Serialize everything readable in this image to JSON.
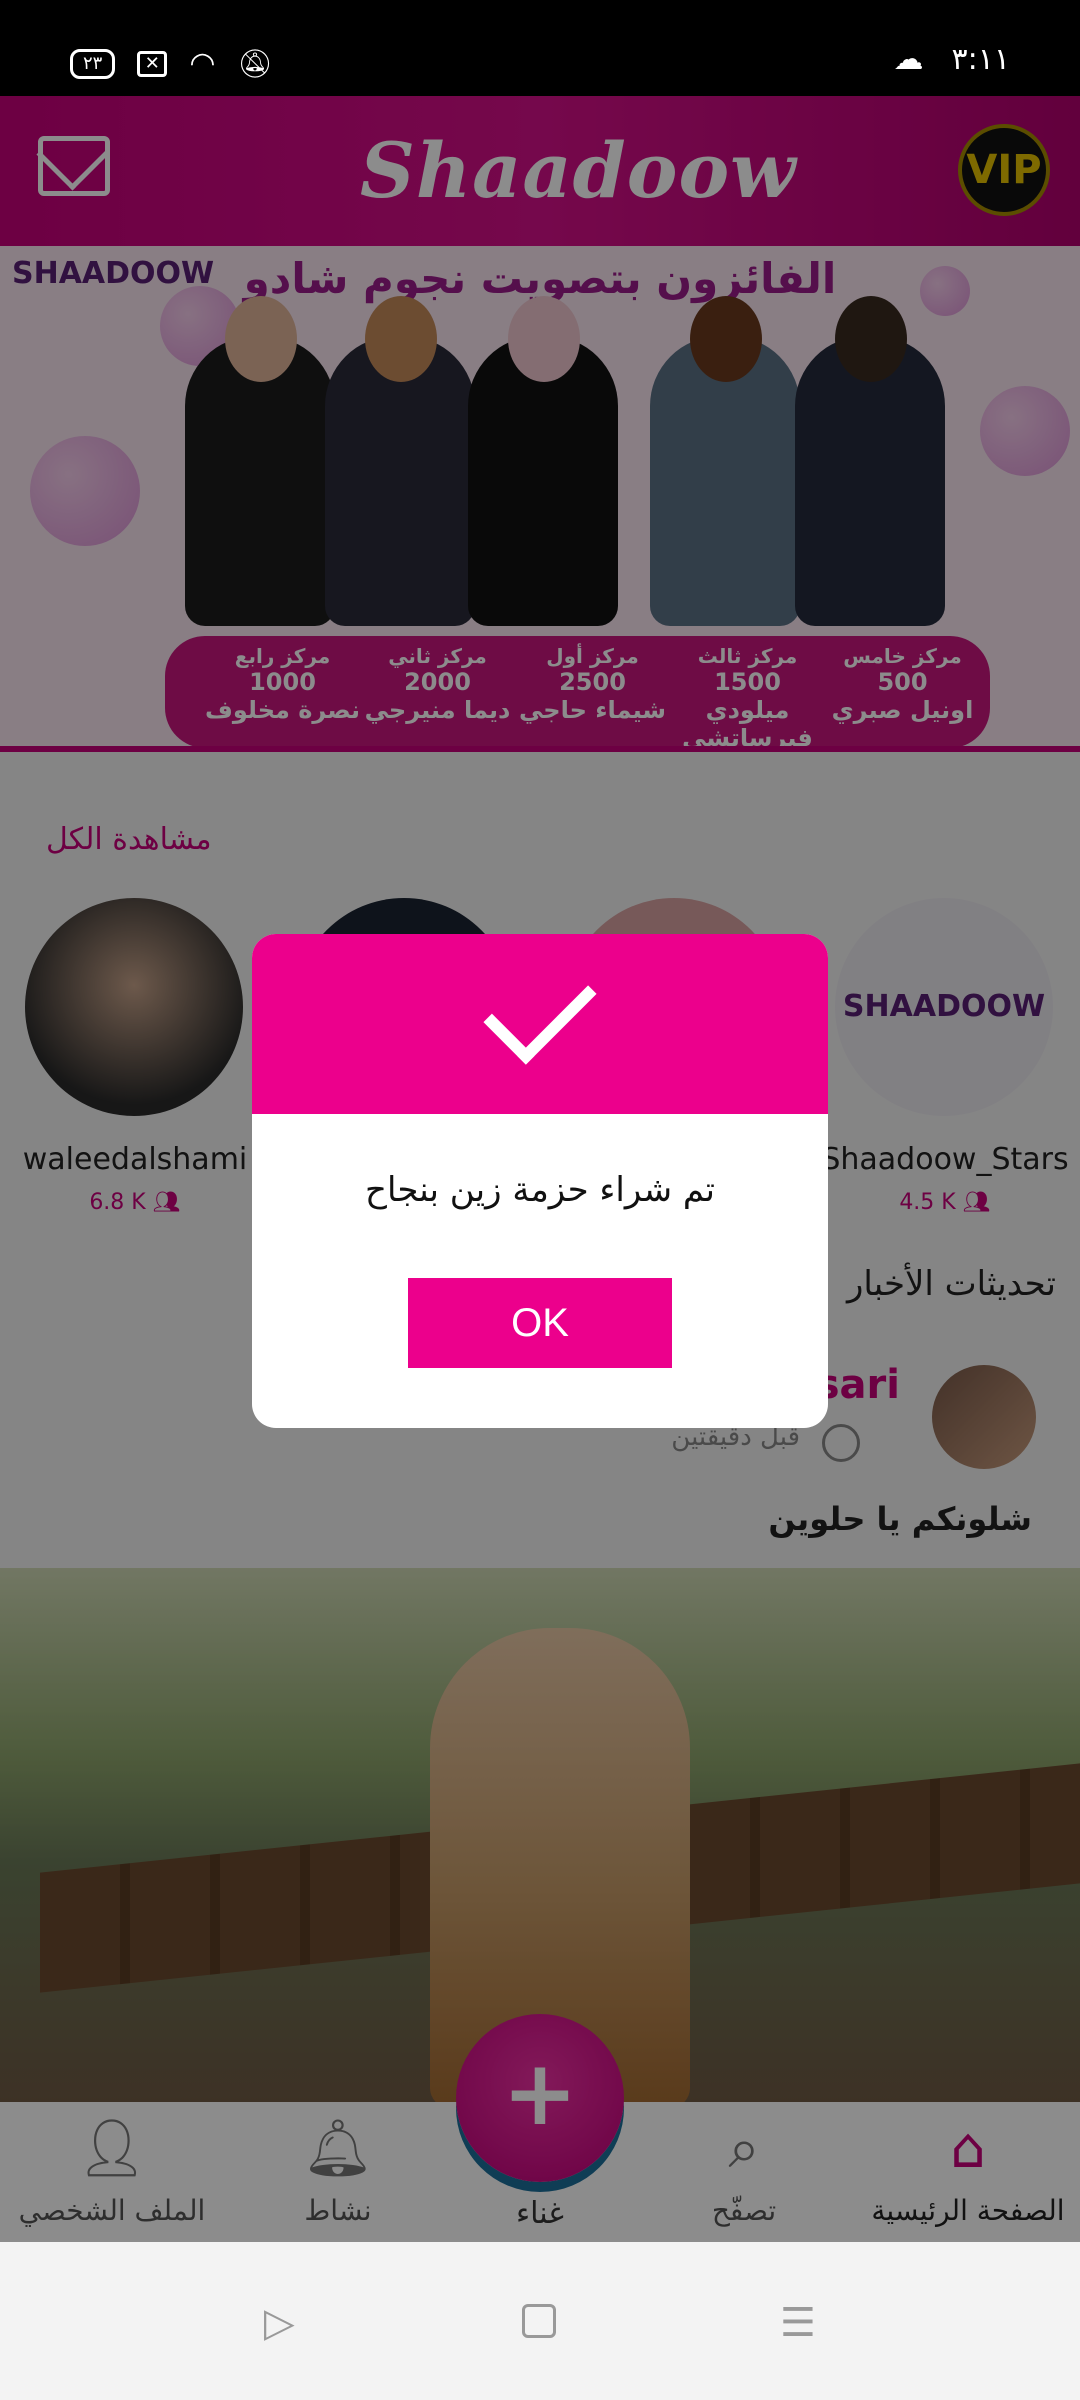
{
  "status_bar": {
    "time": "٣:١١",
    "badge": "٢٣"
  },
  "header": {
    "logo": "Shaadoow",
    "vip": "VIP"
  },
  "banner": {
    "brand": "SHAADOOW",
    "title": "الفائزون بتصويت نجوم شادو",
    "winners": [
      {
        "pos": "مركز خامس",
        "amount": "500",
        "name": "اونيل صبري"
      },
      {
        "pos": "مركز ثالث",
        "amount": "1500",
        "name": "ميلودي فيرساتشي"
      },
      {
        "pos": "مركز أول",
        "amount": "2500",
        "name": "شيماء حاجي"
      },
      {
        "pos": "مركز ثاني",
        "amount": "2000",
        "name": "ديما منيرجي"
      },
      {
        "pos": "مركز رابع",
        "amount": "1000",
        "name": "نصرة مخلوف"
      }
    ]
  },
  "stars": {
    "see_all": "مشاهدة الكل",
    "items": [
      {
        "name": "waleedalshami",
        "count": "6.8 K"
      },
      {
        "name": "Shaadoow_Stars",
        "count": "4.5 K"
      }
    ]
  },
  "news": {
    "title": "تحديثات الأخبار",
    "user": "sari",
    "time": "قبل دقيقتين",
    "text": "شلونكم يا حلوين"
  },
  "bottom_nav": {
    "home": "الصفحة الرئيسية",
    "browse": "تصفّح",
    "sing": "غناء",
    "activity": "نشاط",
    "profile": "الملف الشخصي"
  },
  "dialog": {
    "message": "تم شراء حزمة زين بنجاح",
    "ok": "OK"
  },
  "colors": {
    "brand": "#c6007a",
    "dialog_accent": "#ec008c"
  }
}
